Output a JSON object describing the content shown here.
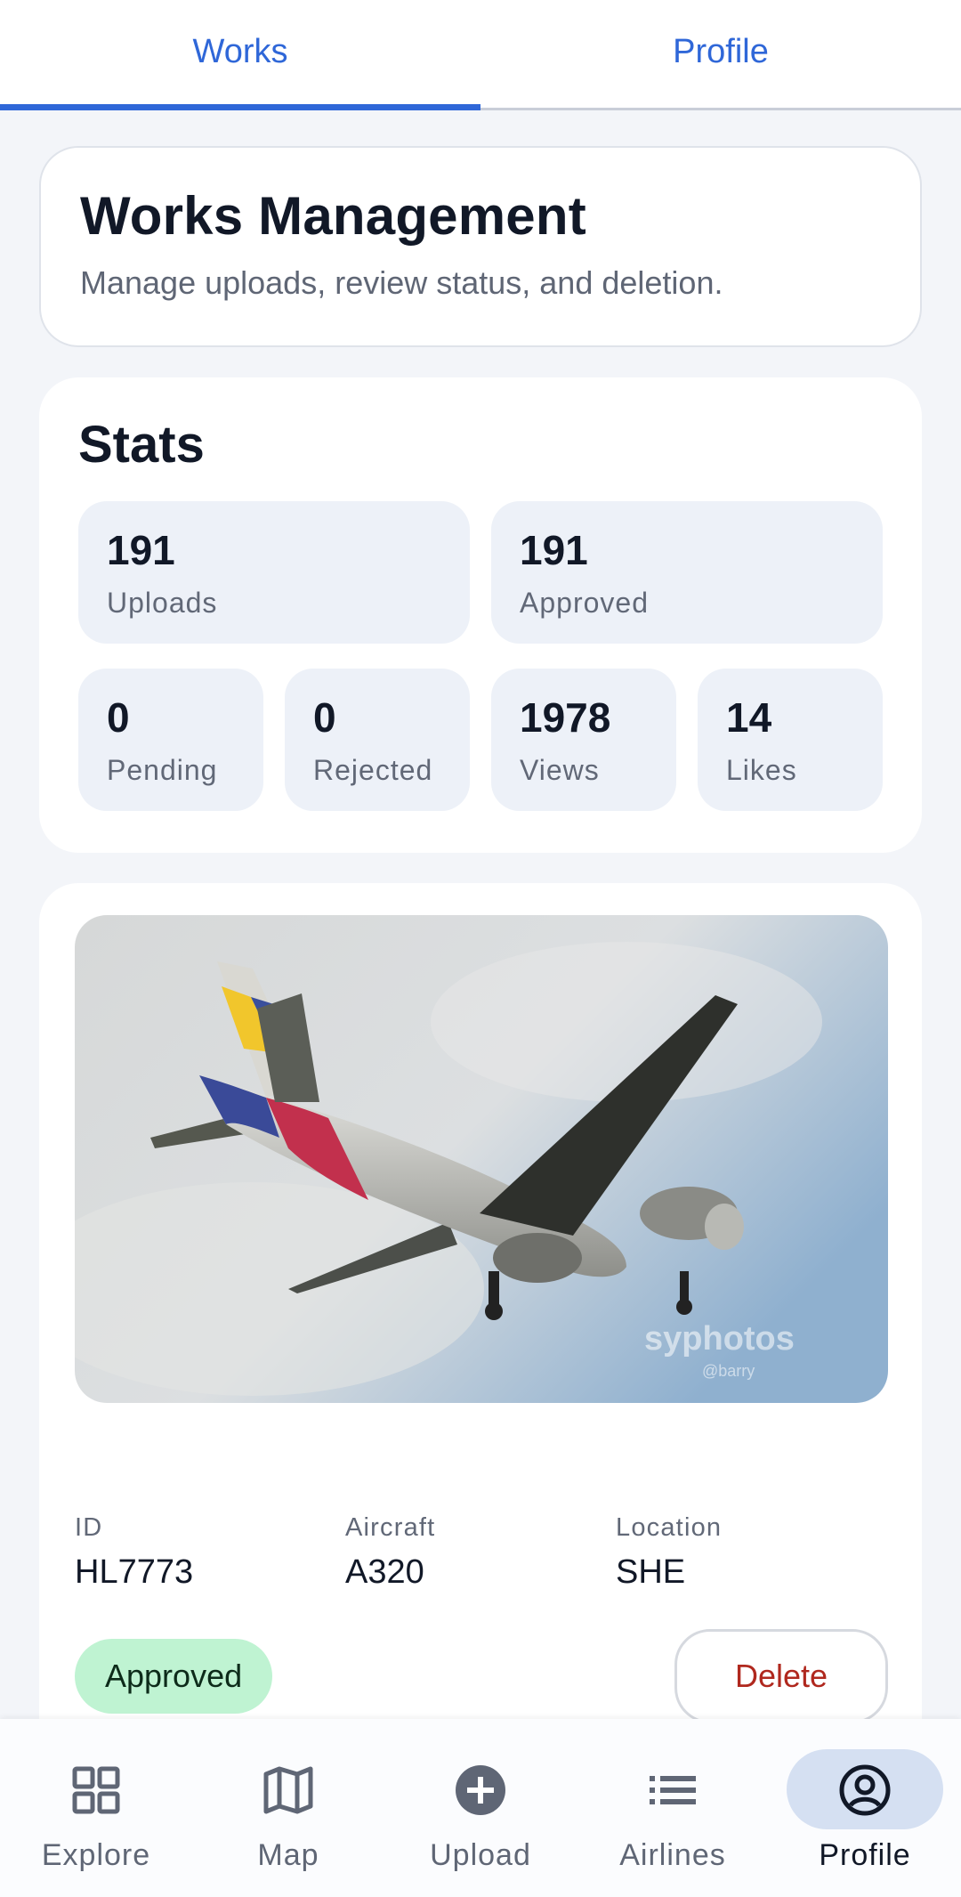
{
  "top_tabs": [
    {
      "label": "Works",
      "active": true
    },
    {
      "label": "Profile",
      "active": false
    }
  ],
  "header": {
    "title": "Works Management",
    "subtitle": "Manage uploads, review status, and deletion."
  },
  "stats": {
    "title": "Stats",
    "row1": [
      {
        "value": "191",
        "label": "Uploads"
      },
      {
        "value": "191",
        "label": "Approved"
      }
    ],
    "row2": [
      {
        "value": "0",
        "label": "Pending"
      },
      {
        "value": "0",
        "label": "Rejected"
      },
      {
        "value": "1978",
        "label": "Views"
      },
      {
        "value": "14",
        "label": "Likes"
      }
    ]
  },
  "work": {
    "watermark": "syphotos",
    "watermark_handle": "@barry",
    "id_label": "ID",
    "id_value": "HL7773",
    "aircraft_label": "Aircraft",
    "aircraft_value": "A320",
    "location_label": "Location",
    "location_value": "SHE",
    "status": "Approved",
    "delete_label": "Delete"
  },
  "bottom_nav": [
    {
      "label": "Explore",
      "icon": "grid-icon",
      "active": false
    },
    {
      "label": "Map",
      "icon": "map-icon",
      "active": false
    },
    {
      "label": "Upload",
      "icon": "plus-circle-icon",
      "active": false
    },
    {
      "label": "Airlines",
      "icon": "list-icon",
      "active": false
    },
    {
      "label": "Profile",
      "icon": "account-circle-icon",
      "active": true
    }
  ],
  "colors": {
    "accent": "#2f67d8",
    "approved_badge": "#bff3d2",
    "delete_text": "#b0281e",
    "stat_tile": "#edf1f8"
  }
}
